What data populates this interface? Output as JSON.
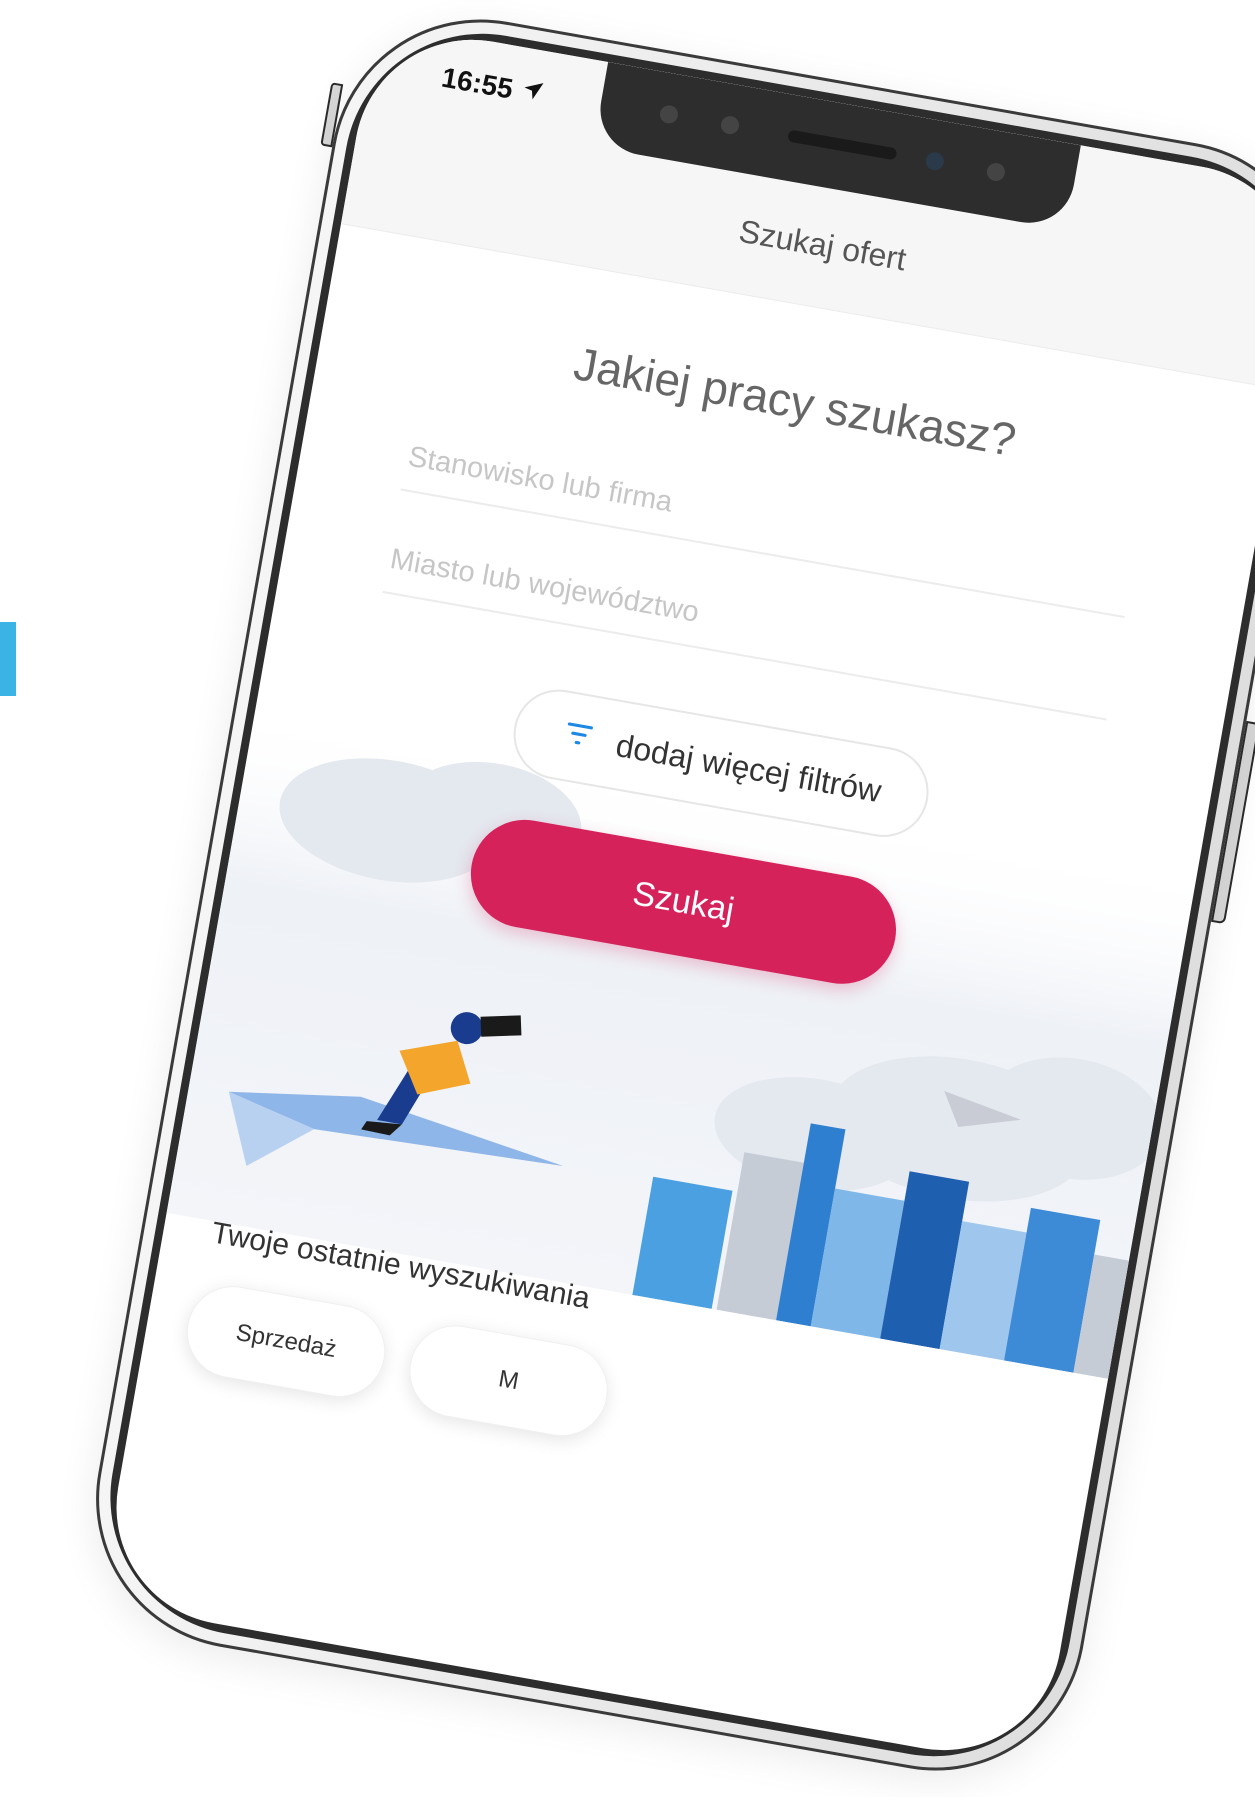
{
  "status_bar": {
    "time": "16:55"
  },
  "header": {
    "title": "Szukaj ofert"
  },
  "search": {
    "heading": "Jakiej pracy szukasz?",
    "position_placeholder": "Stanowisko lub firma",
    "location_placeholder": "Miasto lub województwo",
    "filters_label": "dodaj więcej filtrów",
    "submit_label": "Szukaj"
  },
  "recent": {
    "title": "Twoje ostatnie wyszukiwania",
    "items": [
      "Sprzedaż",
      "M"
    ]
  },
  "colors": {
    "accent_pink": "#d6225b",
    "accent_blue": "#3bb3e4",
    "filter_icon": "#1e88e5"
  },
  "icons": {
    "location_arrow": "location-arrow-icon",
    "filter": "filter-icon"
  }
}
